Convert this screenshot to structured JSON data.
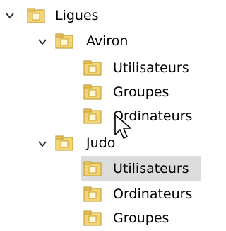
{
  "tree": {
    "root": {
      "label": "Ligues",
      "expanded": true,
      "children": [
        {
          "label": "Aviron",
          "expanded": true,
          "children": [
            {
              "label": "Utilisateurs"
            },
            {
              "label": "Groupes"
            },
            {
              "label": "Ordinateurs"
            }
          ]
        },
        {
          "label": "Judo",
          "expanded": true,
          "children": [
            {
              "label": "Utilisateurs",
              "selected": true
            },
            {
              "label": "Ordinateurs"
            },
            {
              "label": "Groupes"
            }
          ]
        }
      ]
    }
  },
  "colors": {
    "folder_fill": "#f2d675",
    "folder_edge": "#c8a23c",
    "folder_tab": "#e8c35a",
    "selection": "#dcdcdc",
    "chevron": "#333333"
  },
  "icons": {
    "expand": "chevron-down-icon",
    "folder": "folder-icon",
    "cursor": "mouse-pointer-icon"
  }
}
